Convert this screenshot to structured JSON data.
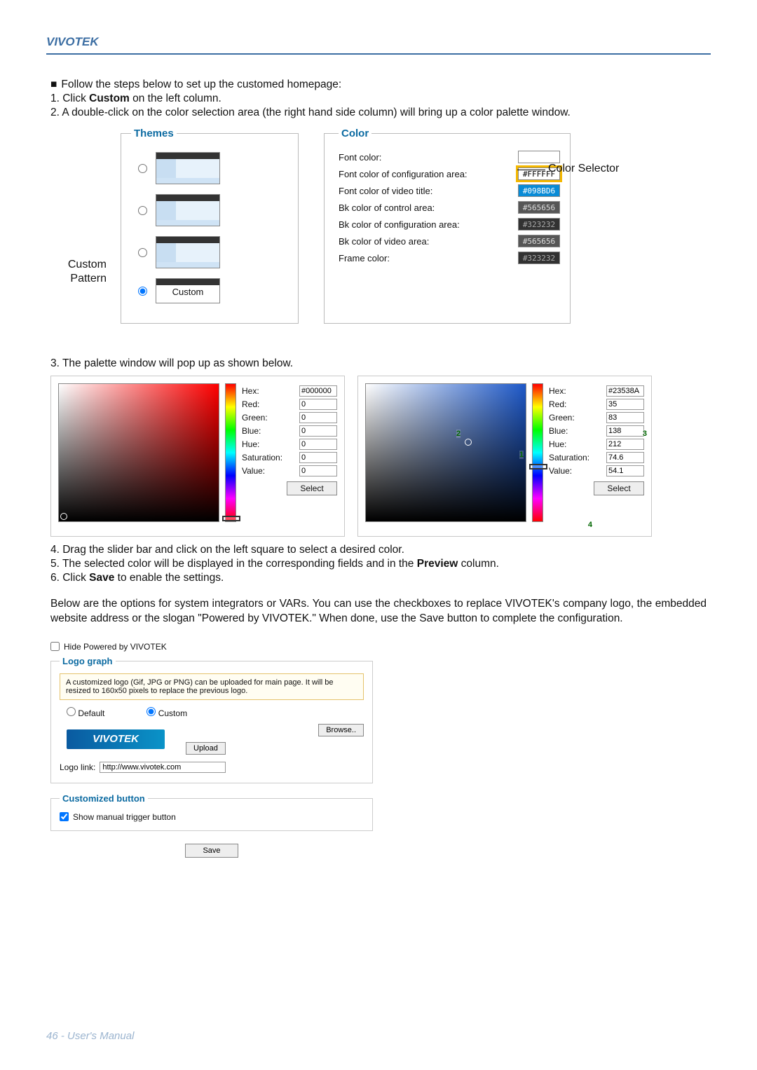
{
  "header": {
    "brand": "VIVOTEK"
  },
  "intro": {
    "lead": "Follow the steps below to set up the customed homepage:",
    "step1_pre": "1. Click ",
    "step1_bold": "Custom",
    "step1_post": " on the left column.",
    "step2": "2. A double-click on the color selection area (the right hand side column) will bring up a color palette window."
  },
  "annotations": {
    "custom_pattern_l1": "Custom",
    "custom_pattern_l2": "Pattern",
    "color_selector": "Color Selector"
  },
  "themes": {
    "legend": "Themes",
    "custom_label": "Custom"
  },
  "colors": {
    "legend": "Color",
    "rows": [
      {
        "label": "Font color:",
        "value": "",
        "bg": "#ffffff",
        "fg": "#000",
        "hi": false
      },
      {
        "label": "Font color of configuration area:",
        "value": "#FFFFFF",
        "bg": "#ffffff",
        "fg": "#000",
        "hi": true
      },
      {
        "label": "Font color of video title:",
        "value": "#098BD6",
        "bg": "#098BD6",
        "fg": "#fff",
        "hi": false
      },
      {
        "label": "Bk color of control area:",
        "value": "#565656",
        "bg": "#565656",
        "fg": "#ddd",
        "hi": false
      },
      {
        "label": "Bk color of configuration area:",
        "value": "#323232",
        "bg": "#323232",
        "fg": "#aaa",
        "hi": false
      },
      {
        "label": "Bk color of video area:",
        "value": "#565656",
        "bg": "#565656",
        "fg": "#ddd",
        "hi": false
      },
      {
        "label": "Frame color:",
        "value": "#323232",
        "bg": "#323232",
        "fg": "#aaa",
        "hi": false
      }
    ]
  },
  "step3": "3. The palette window will pop up as shown below.",
  "palette": {
    "fields": [
      "Hex:",
      "Red:",
      "Green:",
      "Blue:",
      "Hue:",
      "Saturation:",
      "Value:"
    ],
    "a": {
      "Hex": "#000000",
      "Red": "0",
      "Green": "0",
      "Blue": "0",
      "Hue": "0",
      "Saturation": "0",
      "Value": "0"
    },
    "b": {
      "Hex": "#23538A",
      "Red": "35",
      "Green": "83",
      "Blue": "138",
      "Hue": "212",
      "Saturation": "74.6",
      "Value": "54.1"
    },
    "select": "Select",
    "markers": {
      "m1": "1",
      "m2": "2",
      "m3": "3",
      "m4": "4"
    }
  },
  "steps456": {
    "s4": "4. Drag the slider bar and click on the left square to select a desired color.",
    "s5_pre": "5. The selected color will be displayed in the corresponding fields and in the ",
    "s5_bold": "Preview",
    "s5_post": " column.",
    "s6_pre": "6. Click ",
    "s6_bold": "Save",
    "s6_post": " to enable the settings."
  },
  "below_para": "Below are the options for system integrators or VARs. You can use the checkboxes to replace VIVOTEK's company logo, the embedded website address or the slogan \"Powered by VIVOTEK.\" When done, use the Save button to complete the configuration.",
  "logo_panel": {
    "hide_label": "Hide Powered by VIVOTEK",
    "logograph_legend": "Logo graph",
    "note": "A customized logo (Gif, JPG or PNG) can be uploaded for main page. It will be resized to 160x50 pixels to replace the previous logo.",
    "default_label": "Default",
    "custom_label": "Custom",
    "logo_text": "VIVOTEK",
    "browse": "Browse..",
    "upload": "Upload",
    "logo_link_label": "Logo link:",
    "logo_link_value": "http://www.vivotek.com",
    "custbtn_legend": "Customized button",
    "show_trigger": "Show manual trigger button",
    "save": "Save"
  },
  "footer": {
    "text": "46 - User's Manual"
  }
}
